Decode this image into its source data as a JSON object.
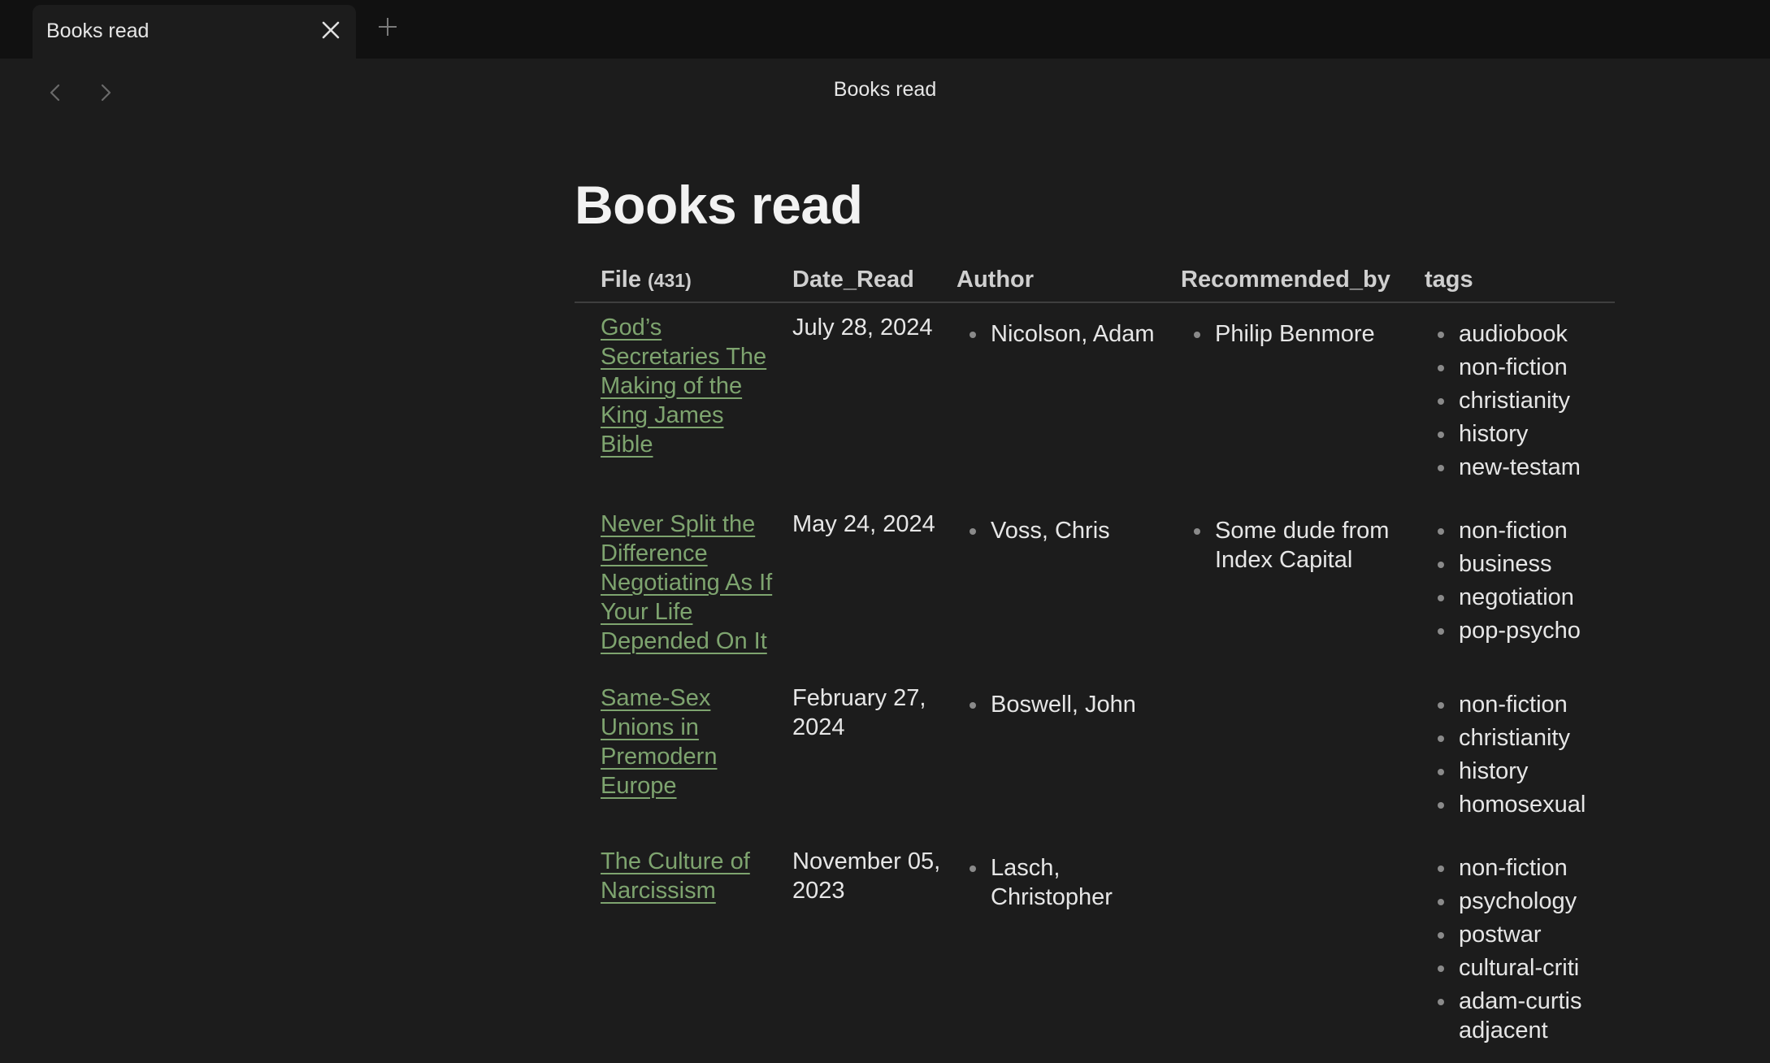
{
  "tab": {
    "title": "Books read"
  },
  "header": {
    "title": "Books read"
  },
  "page": {
    "title": "Books read"
  },
  "table": {
    "columns": {
      "file": "File",
      "file_count": "(431)",
      "date_read": "Date_Read",
      "author": "Author",
      "recommended_by": "Recommended_by",
      "tags": "tags"
    },
    "rows": [
      {
        "file": "God’s Secretaries The Making of the King James Bible",
        "date_read": "July 28, 2024",
        "author": [
          "Nicolson, Adam"
        ],
        "recommended_by": [
          "Philip Benmore"
        ],
        "tags": [
          "audiobook",
          "non-fiction",
          "christianity",
          "history",
          "new-testam"
        ]
      },
      {
        "file": "Never Split the Difference Negotiating As If Your Life Depended On It",
        "date_read": "May 24, 2024",
        "author": [
          "Voss, Chris"
        ],
        "recommended_by": [
          "Some dude from Index Capital"
        ],
        "tags": [
          "non-fiction",
          "business",
          "negotiation",
          "pop-psycho"
        ]
      },
      {
        "file": "Same-Sex Unions in Premodern Europe",
        "date_read": "February 27, 2024",
        "author": [
          "Boswell, John"
        ],
        "recommended_by": [],
        "tags": [
          "non-fiction",
          "christianity",
          "history",
          "homosexual"
        ]
      },
      {
        "file": "The Culture of Narcissism",
        "date_read": "November 05, 2023",
        "author": [
          "Lasch, Christopher"
        ],
        "recommended_by": [],
        "tags": [
          "non-fiction",
          "psychology",
          "postwar",
          "cultural-criti",
          "adam-curtis adjacent"
        ]
      }
    ]
  },
  "icons": {
    "close": "close-icon",
    "new_tab": "plus-icon",
    "back": "chevron-left-icon",
    "forward": "chevron-right-icon"
  },
  "colors": {
    "background": "#1c1c1c",
    "tabbar": "#111111",
    "link": "#7ea46f",
    "text": "#e6e6e6"
  }
}
